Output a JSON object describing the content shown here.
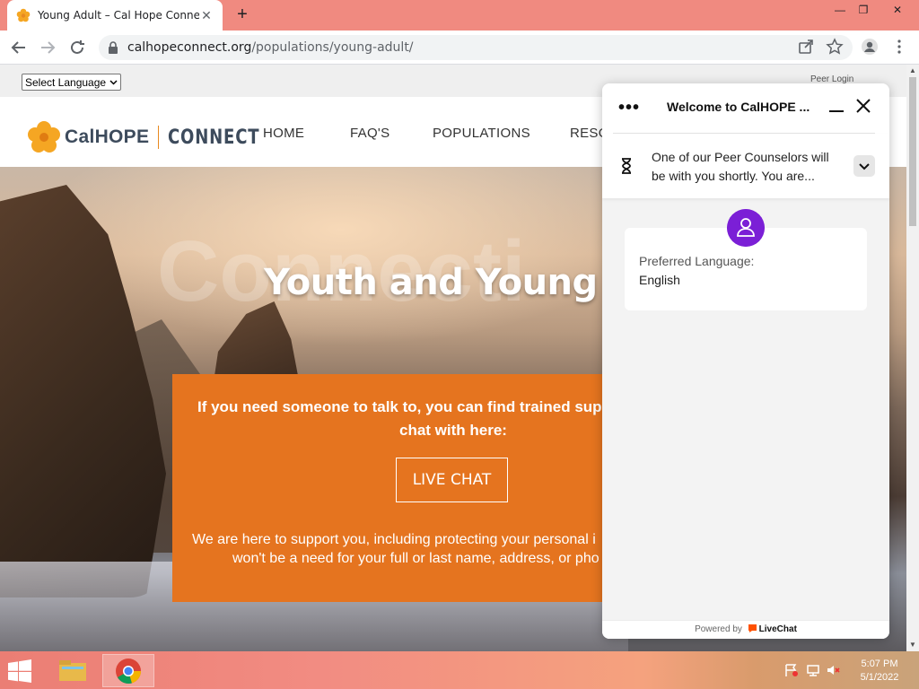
{
  "browser": {
    "tab_title": "Young Adult – Cal Hope Connect",
    "url_host": "calhopeconnect.org",
    "url_path": "/populations/young-adult/"
  },
  "page": {
    "language_select": "Select Language",
    "peer_login": "Peer Login",
    "logo": {
      "cal": "CalHOPE",
      "connect": "CONNECT"
    },
    "nav": [
      {
        "label": "HOME"
      },
      {
        "label": "FAQ'S"
      },
      {
        "label": "POPULATIONS"
      },
      {
        "label": "RESO"
      }
    ],
    "hero": {
      "watermark": "Connecti",
      "title": "Youth and Young Adu"
    },
    "cta": {
      "line1": "If you need someone to talk to, you can find trained supp",
      "line2": "chat with here:",
      "button": "LIVE CHAT",
      "note1": "We are here to support you, including protecting your personal i",
      "note2": "won't be a need for your full or last name, address, or pho"
    }
  },
  "chat": {
    "title": "Welcome to CalHOPE ...",
    "status_line1": "One of our Peer Counselors will",
    "status_line2": "be with you shortly. You are...",
    "message_label": "Preferred Language:",
    "message_value": "English",
    "footer_prefix": "Powered by",
    "footer_brand": "LiveChat"
  },
  "taskbar": {
    "time": "5:07 PM",
    "date": "5/1/2022"
  },
  "colors": {
    "titlebar": "#f08a80",
    "brand_orange": "#e5741f",
    "chat_avatar": "#7b1fd6"
  }
}
